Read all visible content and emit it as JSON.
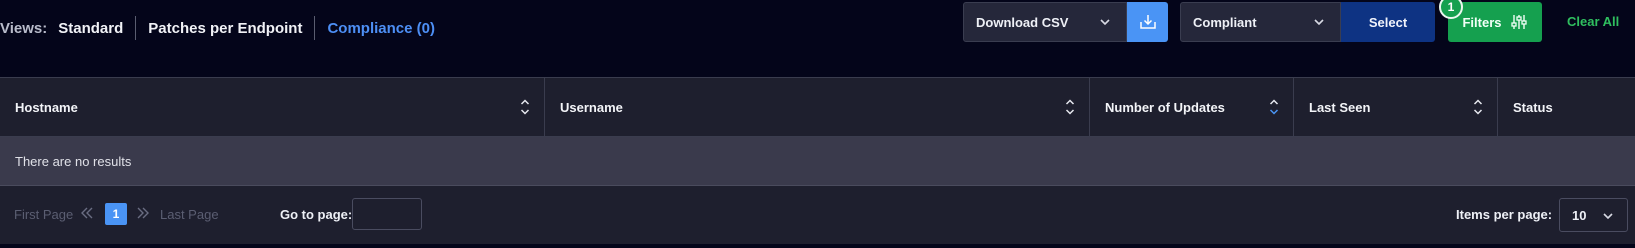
{
  "views": {
    "label": "Views:",
    "items": [
      "Standard",
      "Patches per Endpoint",
      "Compliance (0)"
    ],
    "active_index": 2
  },
  "toolbar": {
    "download_select_value": "Download CSV",
    "download_icon": "download-icon",
    "status_select_value": "Compliant",
    "select_label": "Select",
    "filters_label": "Filters",
    "filters_icon": "sliders-icon",
    "filters_count": "1",
    "clear_all_label": "Clear All"
  },
  "table": {
    "columns": [
      "Hostname",
      "Username",
      "Number of Updates",
      "Last Seen",
      "Status"
    ],
    "sorted_column": "Number of Updates",
    "empty_message": "There are no results"
  },
  "pagination": {
    "first_page_label": "First Page",
    "last_page_label": "Last Page",
    "current_page": "1",
    "goto_label": "Go to page:",
    "goto_value": "",
    "items_per_page_label": "Items per page:",
    "items_per_page_value": "10"
  },
  "colors": {
    "background": "#04051a",
    "accent_blue": "#4a94f5",
    "select_navy": "#0e3383",
    "filters_green": "#15a04f",
    "clear_all_green": "#2fbf5f",
    "table_header": "#1e1f2e",
    "empty_row": "#3a3a4c"
  }
}
